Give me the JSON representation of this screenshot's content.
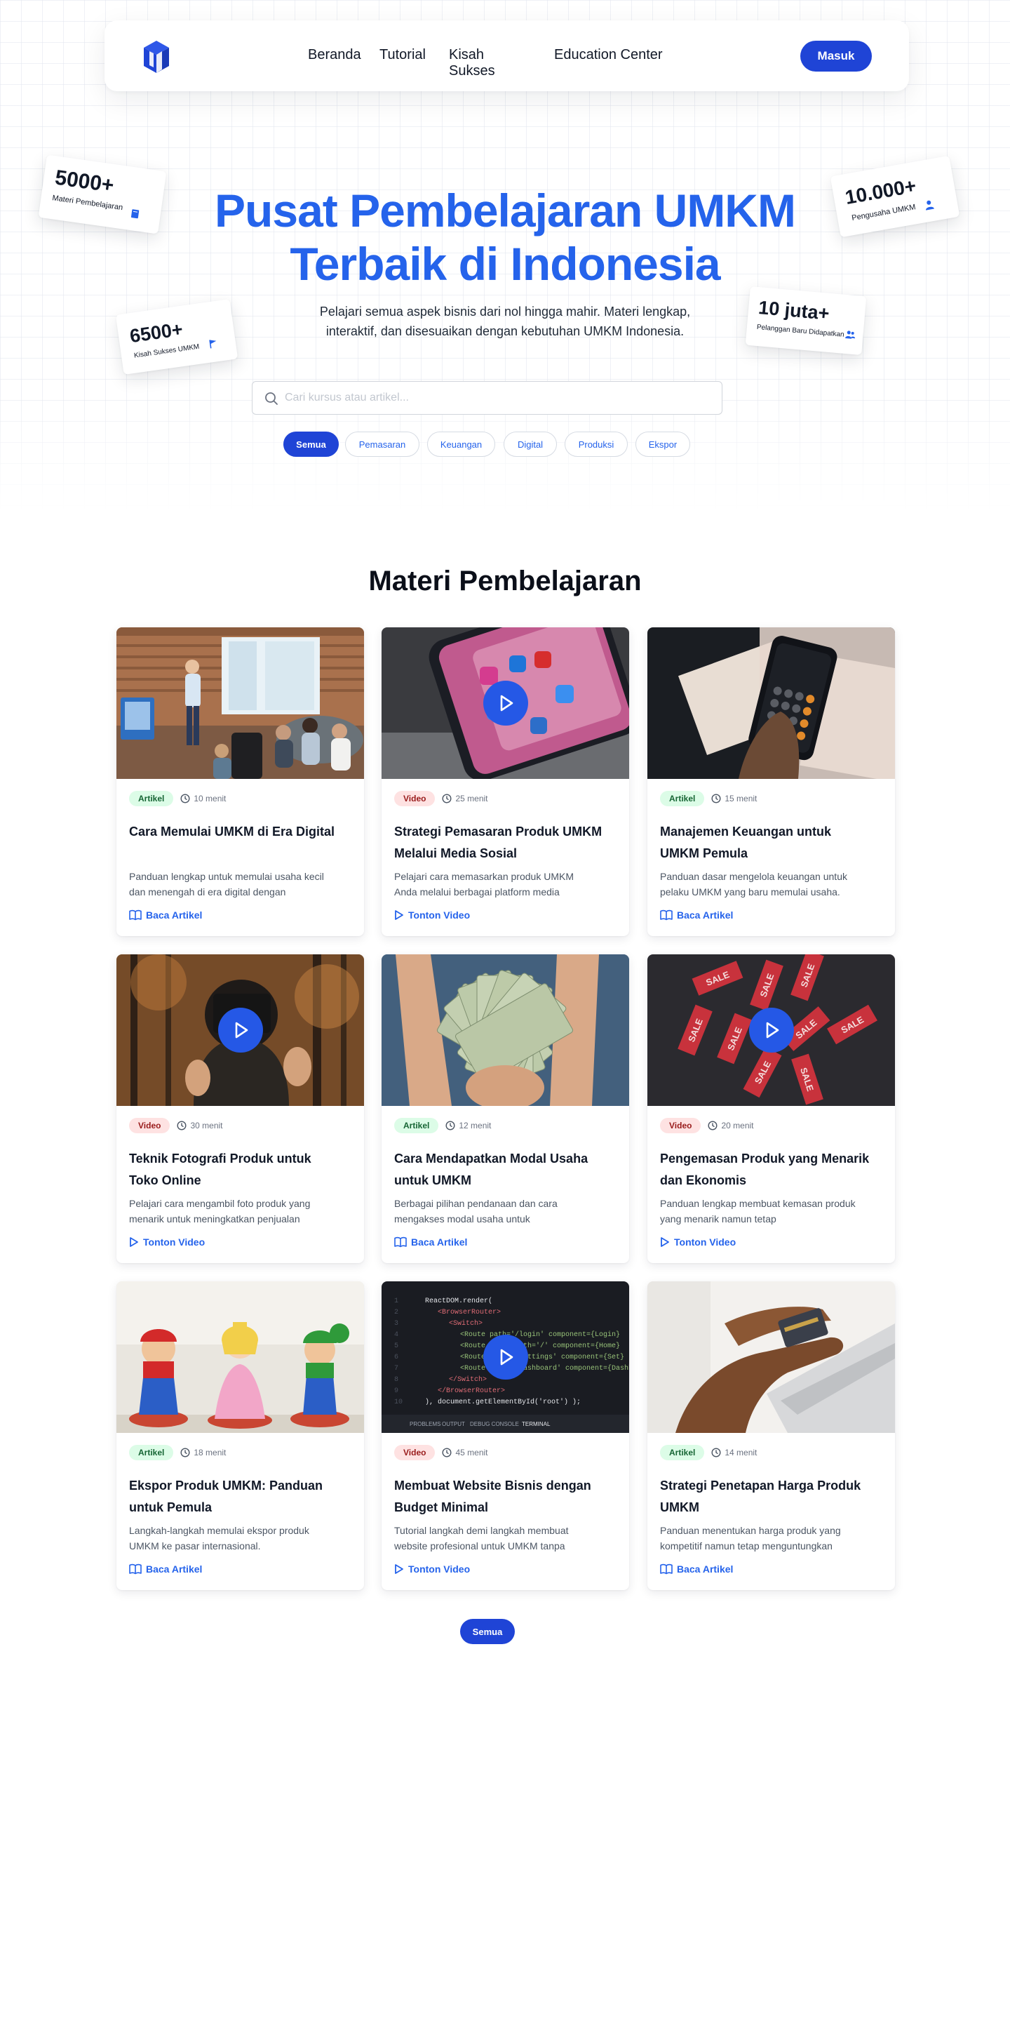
{
  "nav": {
    "links": [
      "Beranda",
      "Tutorial",
      "Kisah Sukses",
      "Education Center"
    ],
    "login_label": "Masuk"
  },
  "hero": {
    "title_line1": "Pusat Pembelajaran UMKM",
    "title_line2": "Terbaik di Indonesia",
    "subtitle": "Pelajari semua aspek bisnis dari nol hingga mahir. Materi lengkap, interaktif, dan disesuaikan dengan kebutuhan UMKM Indonesia.",
    "search_placeholder": "Cari kursus atau artikel...",
    "chips": [
      "Semua",
      "Pemasaran",
      "Keuangan",
      "Digital",
      "Produksi",
      "Ekspor"
    ]
  },
  "stats": [
    {
      "value": "5000+",
      "label": "Materi Pembelajaran",
      "icon": "book-icon"
    },
    {
      "value": "6500+",
      "label": "Kisah Sukses UMKM",
      "icon": "flag-icon"
    },
    {
      "value": "10.000+",
      "label": "Pengusaha UMKM",
      "icon": "user-icon"
    },
    {
      "value": "10 juta+",
      "label": "Pelanggan Baru Didapatkan",
      "icon": "users-icon"
    }
  ],
  "section_title": "Materi Pembelajaran",
  "cards": [
    {
      "type": "Artikel",
      "duration": "10 menit",
      "title": "Cara Memulai UMKM di Era Digital",
      "desc": "Panduan lengkap untuk memulai usaha kecil dan menengah di era digital dengan",
      "action": "Baca Artikel"
    },
    {
      "type": "Video",
      "duration": "25 menit",
      "title": "Strategi Pemasaran Produk UMKM Melalui Media Sosial",
      "desc": "Pelajari cara memasarkan produk UMKM Anda melalui berbagai platform media",
      "action": "Tonton Video"
    },
    {
      "type": "Artikel",
      "duration": "15 menit",
      "title": "Manajemen Keuangan untuk UMKM Pemula",
      "desc": "Panduan dasar mengelola keuangan untuk pelaku UMKM yang baru memulai usaha.",
      "action": "Baca Artikel"
    },
    {
      "type": "Video",
      "duration": "30 menit",
      "title": "Teknik Fotografi Produk untuk Toko Online",
      "desc": "Pelajari cara mengambil foto produk yang menarik untuk meningkatkan penjualan",
      "action": "Tonton Video"
    },
    {
      "type": "Artikel",
      "duration": "12 menit",
      "title": "Cara Mendapatkan Modal Usaha untuk UMKM",
      "desc": "Berbagai pilihan pendanaan dan cara mengakses modal usaha untuk",
      "action": "Baca Artikel"
    },
    {
      "type": "Video",
      "duration": "20 menit",
      "title": "Pengemasan Produk yang Menarik dan Ekonomis",
      "desc": "Panduan lengkap membuat kemasan produk yang menarik namun tetap",
      "action": "Tonton Video"
    },
    {
      "type": "Artikel",
      "duration": "18 menit",
      "title": "Ekspor Produk UMKM: Panduan untuk Pemula",
      "desc": "Langkah-langkah memulai ekspor produk UMKM ke pasar internasional.",
      "action": "Baca Artikel"
    },
    {
      "type": "Video",
      "duration": "45 menit",
      "title": "Membuat Website Bisnis dengan Budget Minimal",
      "desc": "Tutorial langkah demi langkah membuat website profesional untuk UMKM tanpa",
      "action": "Tonton Video"
    },
    {
      "type": "Artikel",
      "duration": "14 menit",
      "title": "Strategi Penetapan Harga Produk UMKM",
      "desc": "Panduan menentukan harga produk yang kompetitif namun tetap menguntungkan",
      "action": "Baca Artikel"
    }
  ],
  "code_thumb": {
    "lines": [
      "ReactDOM.render(",
      "<BrowserRouter>",
      "<Switch>",
      "<Route path='/login' component={Login}",
      "<Route exact path='/' component={Home}",
      "<Route path='/settings' component={Set}",
      "<Route path='/dashboard' component={Dashboard}",
      "</Switch>",
      "</BrowserRouter>",
      "), document.getElementById('root') );"
    ],
    "tabs": [
      "PROBLEMS",
      "OUTPUT",
      "DEBUG CONSOLE",
      "TERMINAL"
    ]
  },
  "sale_tags": [
    "SALE",
    "SALE",
    "SALE",
    "SALE",
    "SALE",
    "SALE",
    "SALE",
    "SALE",
    "SALE"
  ],
  "more_label": "Semua",
  "colors": {
    "primary": "#1f44d6",
    "accent": "#2563eb",
    "artikel_bg": "#dcfce7",
    "video_bg": "#fee2e2"
  }
}
